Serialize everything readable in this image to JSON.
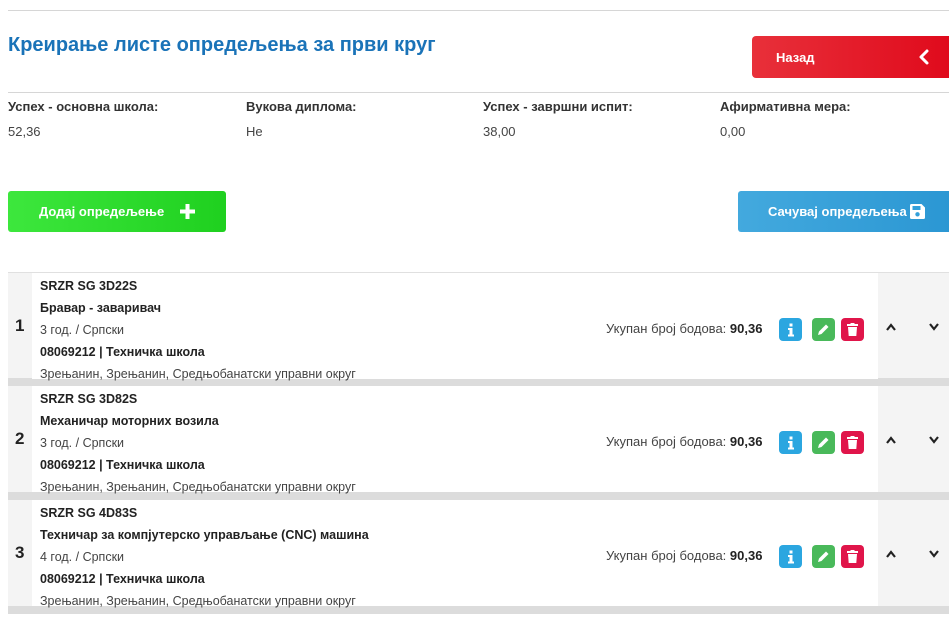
{
  "page_title": "Креирање листе опредељења за први круг",
  "back_button": {
    "label": "Назад"
  },
  "stats": [
    {
      "label": "Успех - основна школа:",
      "value": "52,36"
    },
    {
      "label": "Вукова диплома:",
      "value": "Не"
    },
    {
      "label": "Успех - завршни испит:",
      "value": "38,00"
    },
    {
      "label": "Афирмативна мера:",
      "value": "0,00"
    }
  ],
  "add_button": {
    "label": "Додај опредељење"
  },
  "save_button": {
    "label": "Сачувај опредељења"
  },
  "choices": [
    {
      "rank": "1",
      "code": "SRZR SG 3D22S",
      "profile": "Бравар - заваривач",
      "duration_language": "3 год. / Српски",
      "school": "08069212 | Техничка школа",
      "location": "Зрењанин, Зрењанин, Средњобанатски управни округ",
      "total_label": "Укупан број бодова:",
      "total_value": "90,36"
    },
    {
      "rank": "2",
      "code": "SRZR SG 3D82S",
      "profile": "Механичар моторних возила",
      "duration_language": "3 год. / Српски",
      "school": "08069212 | Техничка школа",
      "location": "Зрењанин, Зрењанин, Средњобанатски управни округ",
      "total_label": "Укупан број бодова:",
      "total_value": "90,36"
    },
    {
      "rank": "3",
      "code": "SRZR SG 4D83S",
      "profile": "Техничар за компјутерско управљање (CNC) машина",
      "duration_language": "4 год. / Српски",
      "school": "08069212 | Техничка школа",
      "location": "Зрењанин, Зрењанин, Средњобанатски управни округ",
      "total_label": "Укупан број бодова:",
      "total_value": "90,36"
    }
  ],
  "icons": {
    "back": "chevron-left-icon",
    "add": "plus-icon",
    "save": "floppy-disk-icon",
    "info": "info-icon",
    "edit": "pencil-icon",
    "delete": "trash-icon",
    "move_up": "chevron-up-icon",
    "move_down": "chevron-down-icon"
  },
  "colors": {
    "title": "#1a73b8",
    "back_button": "#e3101f",
    "add_button": "#2ad62a",
    "save_button": "#34a0da",
    "info": "#2ba6e0",
    "edit": "#49b95a",
    "delete": "#e0154a"
  }
}
